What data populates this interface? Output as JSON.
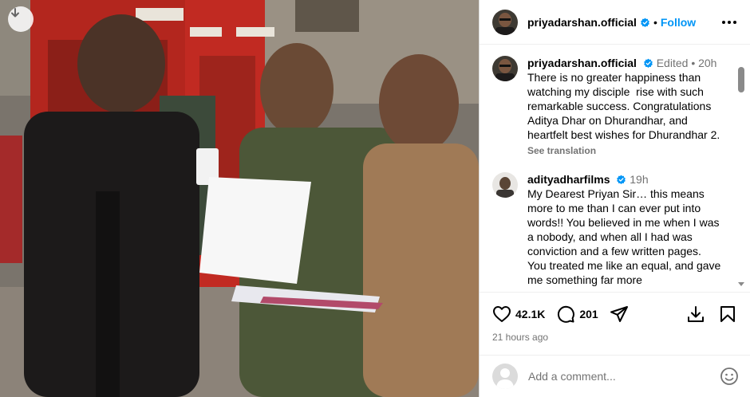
{
  "post": {
    "username": "priyadarshan.official",
    "follow_label": "Follow",
    "separator": "•"
  },
  "comments": [
    {
      "username": "priyadarshan.official",
      "edited": "Edited",
      "dot": "•",
      "time": "20h",
      "text": "There is no greater happiness than watching my disciple  rise with such remarkable success. Congratulations Aditya Dhar on Dhurandhar, and heartfelt best wishes for Dhurandhar 2.",
      "see_translation": "See translation"
    },
    {
      "username": "adityadharfilms",
      "time": "19h",
      "text": "My Dearest Priyan Sir… this means more to me than I can ever put into words!! You believed in me when I was a nobody, and when all I had was conviction and a few written pages.\nYou treated me like an equal, and gave me something far more"
    }
  ],
  "actions": {
    "like_count": "42.1K",
    "comment_count": "201",
    "timestamp": "21 hours ago"
  },
  "add_comment": {
    "placeholder": "Add a comment..."
  },
  "icons": {
    "download": "download-icon",
    "verified": "verified-badge-icon",
    "more": "more-options-icon",
    "like": "heart-icon",
    "comment": "comment-icon",
    "share": "share-icon",
    "save": "save-icon",
    "bookmark": "bookmark-icon",
    "emoji": "emoji-icon"
  },
  "colors": {
    "link_blue": "#0095f6",
    "verified_blue": "#0095f6",
    "muted_text": "#737373",
    "border": "#dbdbdb"
  }
}
